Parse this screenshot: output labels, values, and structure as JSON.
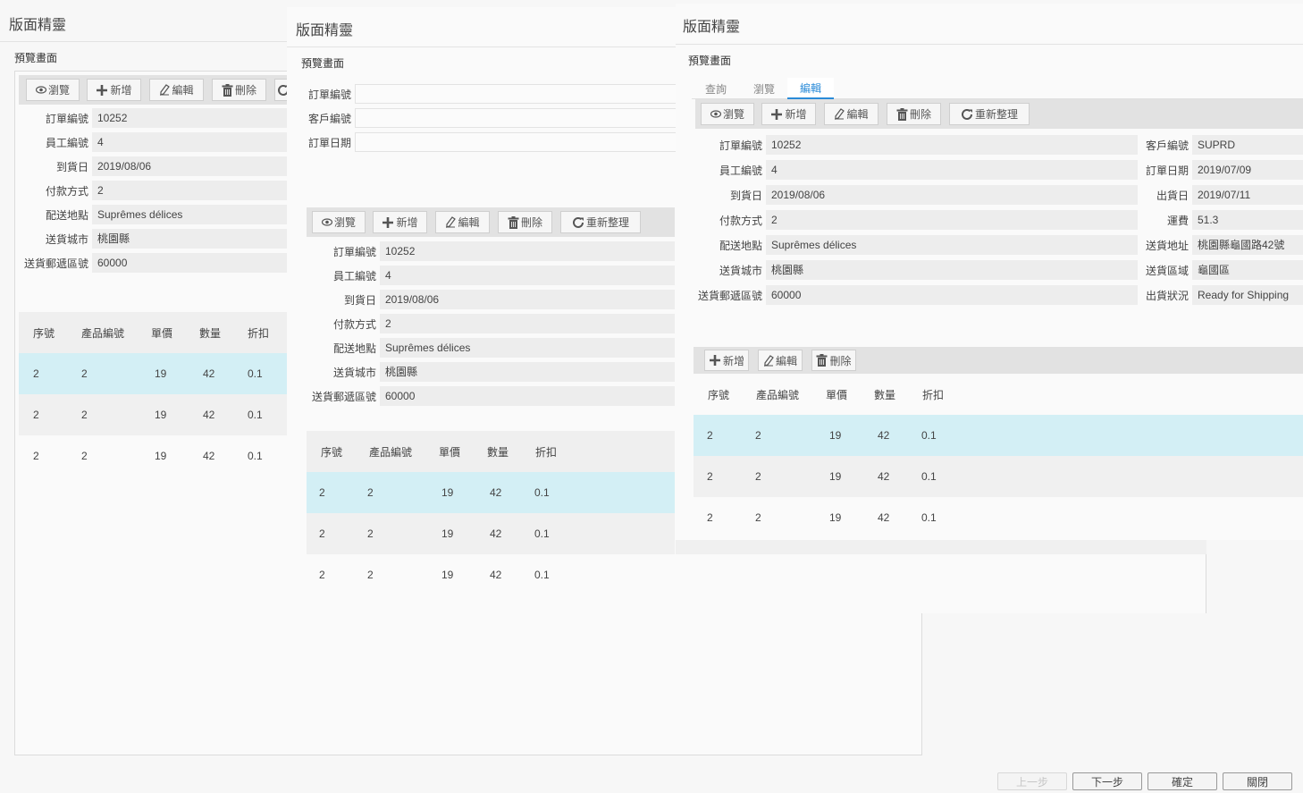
{
  "window": {
    "title": "版面精靈",
    "preview_label": "預覽畫面"
  },
  "colors": {
    "selected_row": "#d3eff5",
    "alt_row": "#f0f0f0",
    "toolbar": "#e2e2e2",
    "tab_active": "#2b8bd8"
  },
  "toolbar": {
    "browse": "瀏覽",
    "add": "新增",
    "edit": "編輯",
    "delete": "刪除",
    "refresh": "重新整理",
    "icons": {
      "browse": "eye-icon",
      "add": "plus-icon",
      "edit": "pencil-icon",
      "delete": "trash-icon",
      "refresh": "refresh-icon"
    }
  },
  "tabs": [
    {
      "label": "查詢"
    },
    {
      "label": "瀏覽"
    },
    {
      "label": "編輯"
    }
  ],
  "query": {
    "order_no_label": "訂單編號",
    "customer_no_label": "客戶編號",
    "order_date_label": "訂單日期"
  },
  "form": {
    "order_no": {
      "label": "訂單編號",
      "value": "10252"
    },
    "employee_no": {
      "label": "員工編號",
      "value": "4"
    },
    "arrival_date": {
      "label": "到貨日",
      "value": "2019/08/06"
    },
    "payment": {
      "label": "付款方式",
      "value": "2"
    },
    "ship_place": {
      "label": "配送地點",
      "value": "Suprêmes délices"
    },
    "ship_city": {
      "label": "送貨城市",
      "value": "桃園縣"
    },
    "ship_zip": {
      "label": "送貨郵遞區號",
      "value": "60000"
    },
    "customer_no": {
      "label": "客戶編號",
      "value": "SUPRD"
    },
    "order_date": {
      "label": "訂單日期",
      "value": "2019/07/09"
    },
    "ship_date": {
      "label": "出貨日",
      "value": "2019/07/11"
    },
    "freight": {
      "label": "運費",
      "value": "51.3"
    },
    "ship_address": {
      "label": "送貨地址",
      "value": "桃園縣龜國路42號"
    },
    "ship_district": {
      "label": "送貨區域",
      "value": "龜國區"
    },
    "ship_status": {
      "label": "出貨狀況",
      "value": "Ready for Shipping"
    }
  },
  "grid": {
    "headers": [
      "序號",
      "產品編號",
      "單價",
      "數量",
      "折扣"
    ],
    "rows": [
      [
        "2",
        "2",
        "19",
        "42",
        "0.1"
      ],
      [
        "2",
        "2",
        "19",
        "42",
        "0.1"
      ],
      [
        "2",
        "2",
        "19",
        "42",
        "0.1"
      ]
    ]
  },
  "footer": {
    "prev": "上一步",
    "next": "下一步",
    "ok": "確定",
    "close": "關閉"
  }
}
